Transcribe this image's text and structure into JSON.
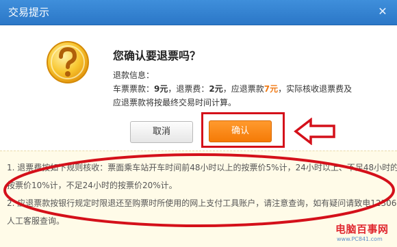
{
  "window": {
    "title": "交易提示",
    "close_glyph": "✕"
  },
  "dialog": {
    "heading": "您确认要退票吗？",
    "info_label": "退款信息：",
    "ticket_fare_label": "车票票款：",
    "ticket_fare_value": "9元",
    "refund_fee_label": "，退票费：",
    "refund_fee_value": "2元",
    "refund_amount_label": "，应退票款",
    "refund_amount_value": "7元",
    "tail_text": "，实际核收退票费及",
    "line2": "应退票款将按最终交易时间计算。",
    "cancel_label": "取消",
    "confirm_label": "确认"
  },
  "notice": {
    "items": [
      "1. 退票费按如下规则核收：票面乘车站开车时间前48小时以上的按票价5%计，24小时以上、不足48小时的",
      "按票价10%计，不足24小时的按票价20%计。",
      "2. 应退票款按银行规定时限退还至购票时所使用的网上支付工具账户，请注意查询，如有疑问请致电12306",
      "人工客服查询。"
    ]
  },
  "watermark": {
    "main": "电脑百事网",
    "sub": "www.PC841.com"
  },
  "colors": {
    "titlebar": "#2b77c7",
    "confirm": "#f57a06",
    "highlight": "#d4101a",
    "notice_bg": "#fffbe8"
  },
  "icons": {
    "question": "question-mark-icon",
    "close": "close-icon",
    "arrow": "left-arrow-icon"
  }
}
